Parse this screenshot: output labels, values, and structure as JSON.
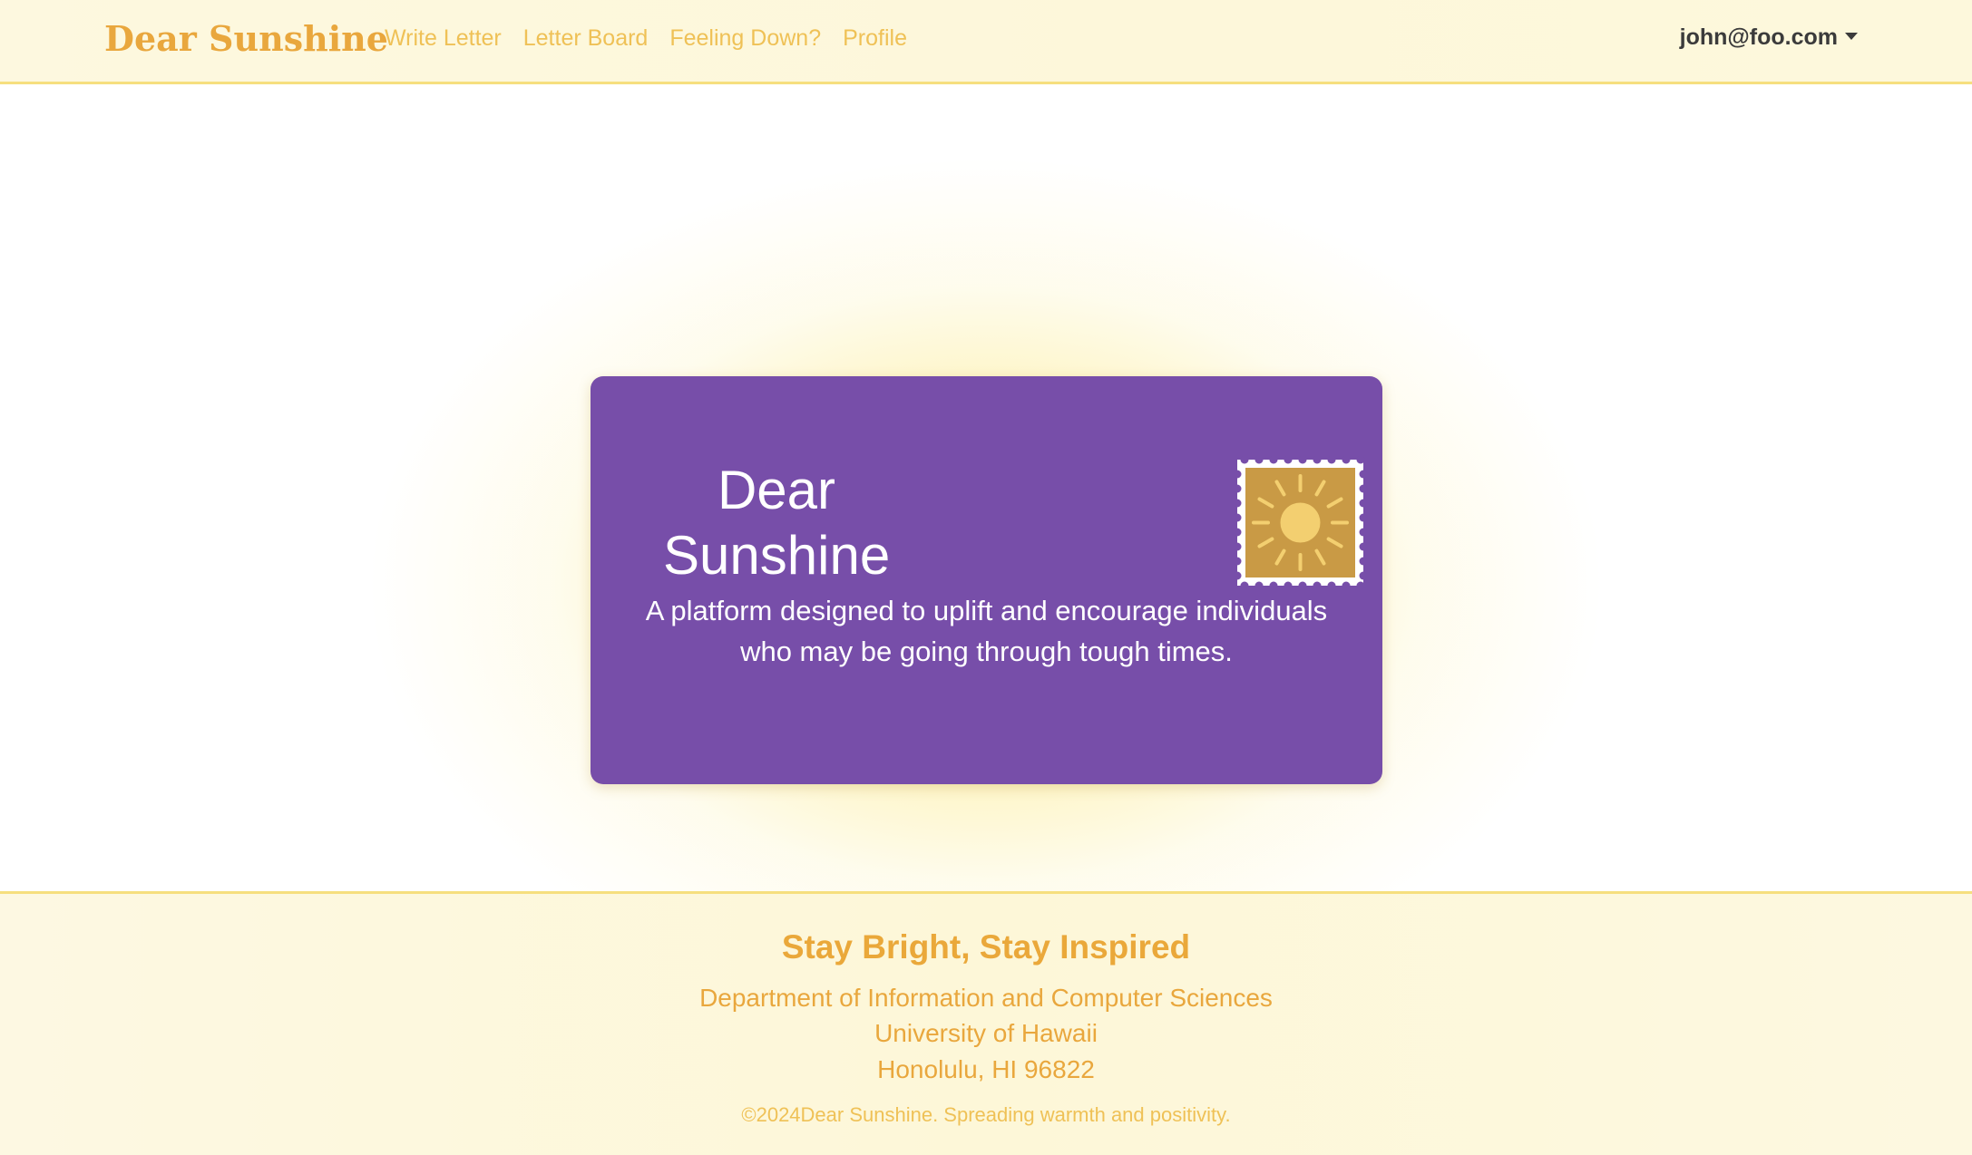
{
  "navbar": {
    "brand": "Dear Sunshine",
    "links": [
      {
        "label": "Write Letter"
      },
      {
        "label": "Letter Board"
      },
      {
        "label": "Feeling Down?"
      },
      {
        "label": "Profile"
      }
    ],
    "user_email": "john@foo.com"
  },
  "hero": {
    "title_line1": "Dear",
    "title_line2": "Sunshine",
    "description_line1": "A platform designed to uplift and encourage individuals",
    "description_line2": "who may be going through tough times.",
    "stamp_icon": "sun-stamp-icon"
  },
  "footer": {
    "title": "Stay Bright, Stay Inspired",
    "department": "Department of Information and Computer Sciences",
    "university": "University of Hawaii",
    "location": "Honolulu, HI 96822",
    "copyright": "©2024Dear Sunshine. Spreading warmth and positivity."
  },
  "colors": {
    "brand_gold": "#e9a73d",
    "nav_link": "#efc156",
    "card_purple": "#774ea9",
    "stamp_bg": "#c99a45",
    "sun_yellow": "#f3cf70"
  }
}
